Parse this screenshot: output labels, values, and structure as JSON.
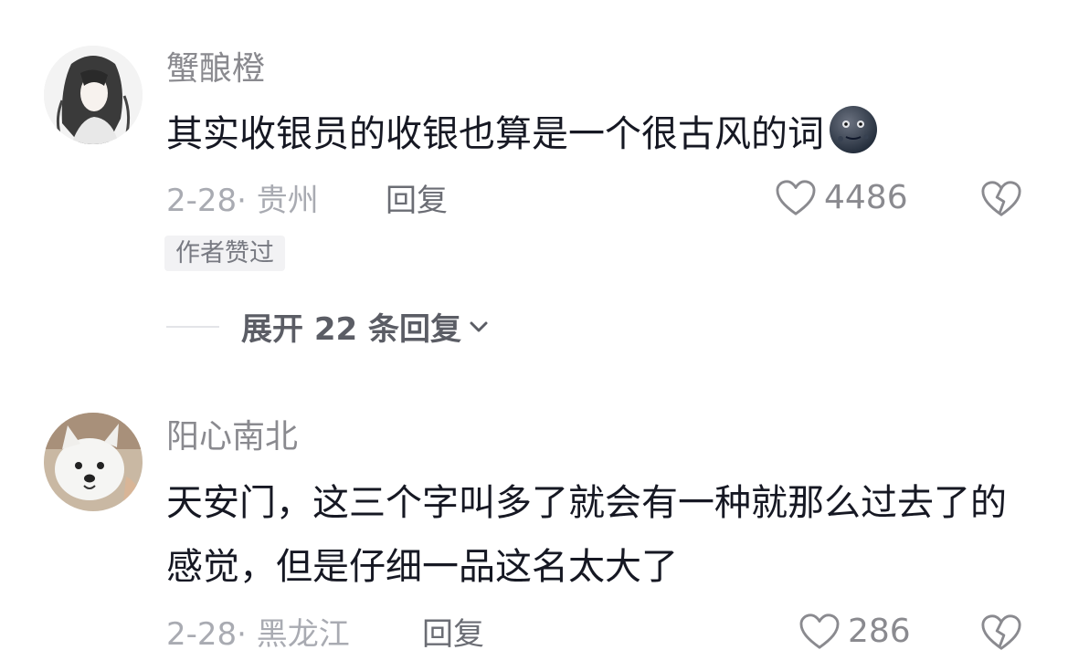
{
  "comments": [
    {
      "username": "蟹酿橙",
      "text": "其实收银员的收银也算是一个很古风的词",
      "emoji": "new-moon-face-emoji",
      "date": "2-28",
      "location": "· 贵州",
      "reply_label": "回复",
      "likes": "4486",
      "badge": "作者赞过",
      "avatar": "anime-longhair-avatar"
    },
    {
      "username": "阳心南北",
      "text": "天安门，这三个字叫多了就会有一种就那么过去了的感觉，但是仔细一品这名太大了",
      "date": "2-28",
      "location": "· 黑龙江",
      "reply_label": "回复",
      "likes": "286",
      "avatar": "white-dog-avatar"
    }
  ],
  "expand_replies": {
    "label": "展开 22 条回复"
  },
  "colors": {
    "text": "#161823",
    "secondary": "#8a8a8f",
    "muted": "#a9abb2"
  }
}
